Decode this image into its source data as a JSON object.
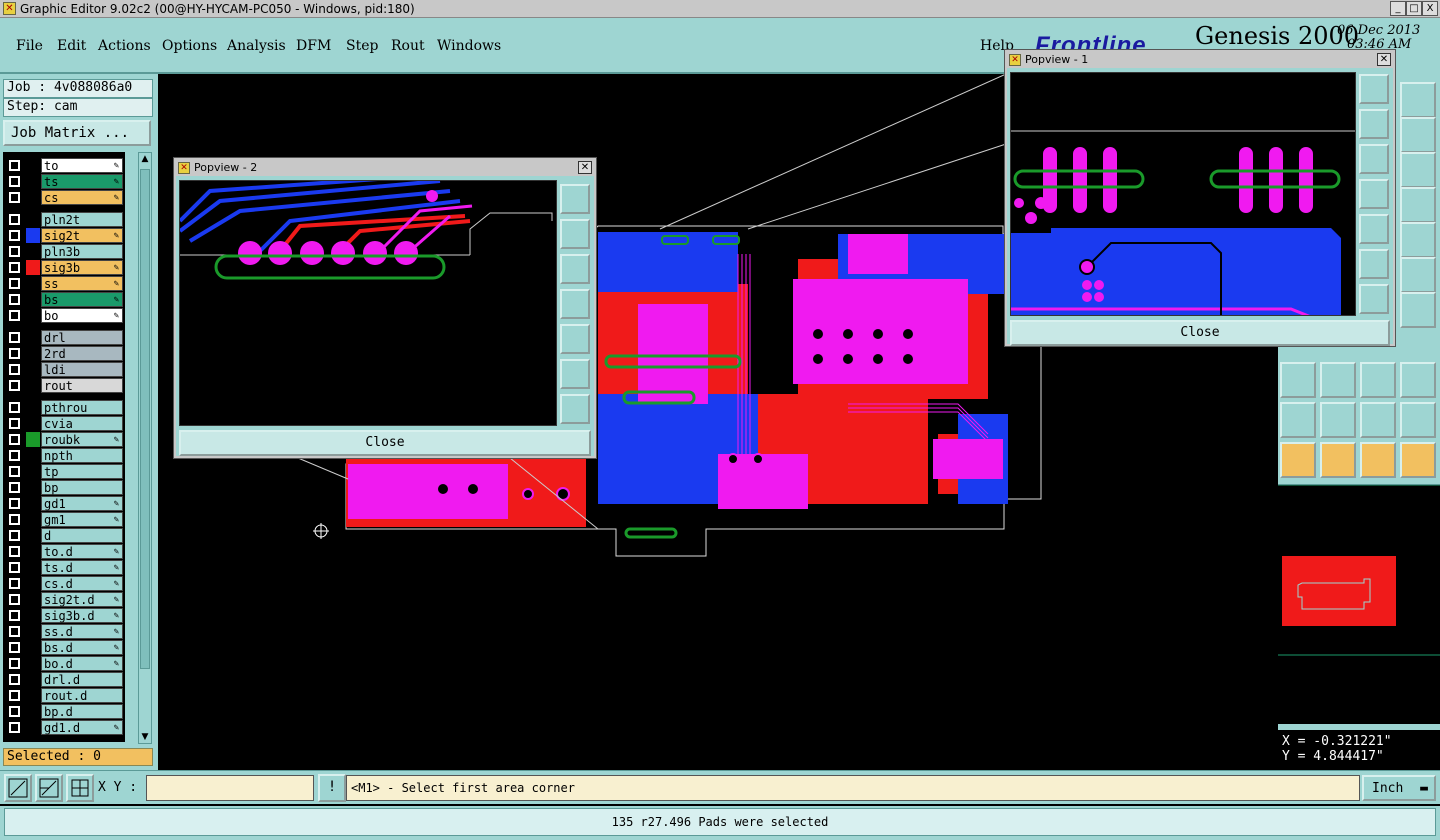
{
  "window": {
    "title": "Graphic Editor 9.02c2 (00@HY-HYCAM-PC050 - Windows, pid:180)",
    "controls": [
      "_",
      "□",
      "X"
    ]
  },
  "menu": {
    "items": [
      "File",
      "Edit",
      "Actions",
      "Options",
      "Analysis",
      "DFM",
      "Step",
      "Rout",
      "Windows"
    ],
    "help": "Help"
  },
  "brand": {
    "logo": "Frontline",
    "product": "Genesis 2000",
    "date": "06 Dec 2013",
    "time": "03:46 AM"
  },
  "job": {
    "job_label": "Job : 4v088086a0",
    "step_label": "Step: cam",
    "matrix_button": "Job Matrix ..."
  },
  "layers": [
    {
      "name": "to",
      "bg": "#ffffff",
      "swatch": "#000000",
      "edit": true,
      "group": 0
    },
    {
      "name": "ts",
      "bg": "#1a9a6a",
      "swatch": "#000000",
      "edit": true,
      "group": 0
    },
    {
      "name": "cs",
      "bg": "#f2c060",
      "swatch": "#000000",
      "edit": true,
      "group": 0
    },
    {
      "name": "pln2t",
      "bg": "#9ed5d2",
      "swatch": "#000000",
      "edit": false,
      "group": 1
    },
    {
      "name": "sig2t",
      "bg": "#f2c060",
      "swatch": "#1a3af0",
      "edit": true,
      "group": 1
    },
    {
      "name": "pln3b",
      "bg": "#9ed5d2",
      "swatch": "#000000",
      "edit": false,
      "group": 1
    },
    {
      "name": "sig3b",
      "bg": "#f2c060",
      "swatch": "#f01a1a",
      "edit": true,
      "group": 1
    },
    {
      "name": "ss",
      "bg": "#f2c060",
      "swatch": "#000000",
      "edit": true,
      "group": 1
    },
    {
      "name": "bs",
      "bg": "#1a9a6a",
      "swatch": "#000000",
      "edit": true,
      "group": 1
    },
    {
      "name": "bo",
      "bg": "#ffffff",
      "swatch": "#000000",
      "edit": true,
      "group": 1
    },
    {
      "name": "drl",
      "bg": "#a8b8c0",
      "swatch": "#000000",
      "edit": false,
      "group": 2
    },
    {
      "name": "2rd",
      "bg": "#a8b8c0",
      "swatch": "#000000",
      "edit": false,
      "group": 2
    },
    {
      "name": "ldi",
      "bg": "#a8b8c0",
      "swatch": "#000000",
      "edit": false,
      "group": 2
    },
    {
      "name": "rout",
      "bg": "#d8d8d8",
      "swatch": "#000000",
      "edit": false,
      "group": 2
    },
    {
      "name": "pthrou",
      "bg": "#9ed5d2",
      "swatch": "#000000",
      "edit": false,
      "group": 3
    },
    {
      "name": "cvia",
      "bg": "#9ed5d2",
      "swatch": "#000000",
      "edit": false,
      "group": 3
    },
    {
      "name": "roubk",
      "bg": "#9ed5d2",
      "swatch": "#1a9a2a",
      "edit": true,
      "group": 3
    },
    {
      "name": "npth",
      "bg": "#9ed5d2",
      "swatch": "#000000",
      "edit": false,
      "group": 3
    },
    {
      "name": "tp",
      "bg": "#9ed5d2",
      "swatch": "#000000",
      "edit": false,
      "group": 3
    },
    {
      "name": "bp",
      "bg": "#9ed5d2",
      "swatch": "#000000",
      "edit": false,
      "group": 3
    },
    {
      "name": "gd1",
      "bg": "#9ed5d2",
      "swatch": "#000000",
      "edit": true,
      "group": 3
    },
    {
      "name": "gm1",
      "bg": "#9ed5d2",
      "swatch": "#000000",
      "edit": true,
      "group": 3
    },
    {
      "name": "d",
      "bg": "#9ed5d2",
      "swatch": "#000000",
      "edit": false,
      "group": 3
    },
    {
      "name": "to.d",
      "bg": "#9ed5d2",
      "swatch": "#000000",
      "edit": true,
      "group": 3
    },
    {
      "name": "ts.d",
      "bg": "#9ed5d2",
      "swatch": "#000000",
      "edit": true,
      "group": 3
    },
    {
      "name": "cs.d",
      "bg": "#9ed5d2",
      "swatch": "#000000",
      "edit": true,
      "group": 3
    },
    {
      "name": "sig2t.d",
      "bg": "#9ed5d2",
      "swatch": "#000000",
      "edit": true,
      "group": 3
    },
    {
      "name": "sig3b.d",
      "bg": "#9ed5d2",
      "swatch": "#000000",
      "edit": true,
      "group": 3
    },
    {
      "name": "ss.d",
      "bg": "#9ed5d2",
      "swatch": "#000000",
      "edit": true,
      "group": 3
    },
    {
      "name": "bs.d",
      "bg": "#9ed5d2",
      "swatch": "#000000",
      "edit": true,
      "group": 3
    },
    {
      "name": "bo.d",
      "bg": "#9ed5d2",
      "swatch": "#000000",
      "edit": true,
      "group": 3
    },
    {
      "name": "drl.d",
      "bg": "#9ed5d2",
      "swatch": "#000000",
      "edit": false,
      "group": 3
    },
    {
      "name": "rout.d",
      "bg": "#9ed5d2",
      "swatch": "#000000",
      "edit": false,
      "group": 3
    },
    {
      "name": "bp.d",
      "bg": "#9ed5d2",
      "swatch": "#000000",
      "edit": false,
      "group": 3
    },
    {
      "name": "gd1.d",
      "bg": "#9ed5d2",
      "swatch": "#000000",
      "edit": true,
      "group": 3
    }
  ],
  "selected": "Selected : 0",
  "popview1": {
    "title": "Popview - 1",
    "close": "Close"
  },
  "popview2": {
    "title": "Popview - 2",
    "close": "Close"
  },
  "coords": {
    "x": "X = -0.321221\"",
    "y": "Y = 4.844417\""
  },
  "bottom": {
    "xy_label": "X Y :",
    "xy_value": "",
    "bang": "!",
    "prompt": "<M1> - Select first area corner",
    "units": "Inch"
  },
  "status": "135 r27.496 Pads were selected",
  "colors": {
    "top": "#1a3af0",
    "bottom": "#f01a1a",
    "overlap": "#f01af0",
    "panel": "#9ed5d2",
    "outline": "#1a9a2a"
  }
}
